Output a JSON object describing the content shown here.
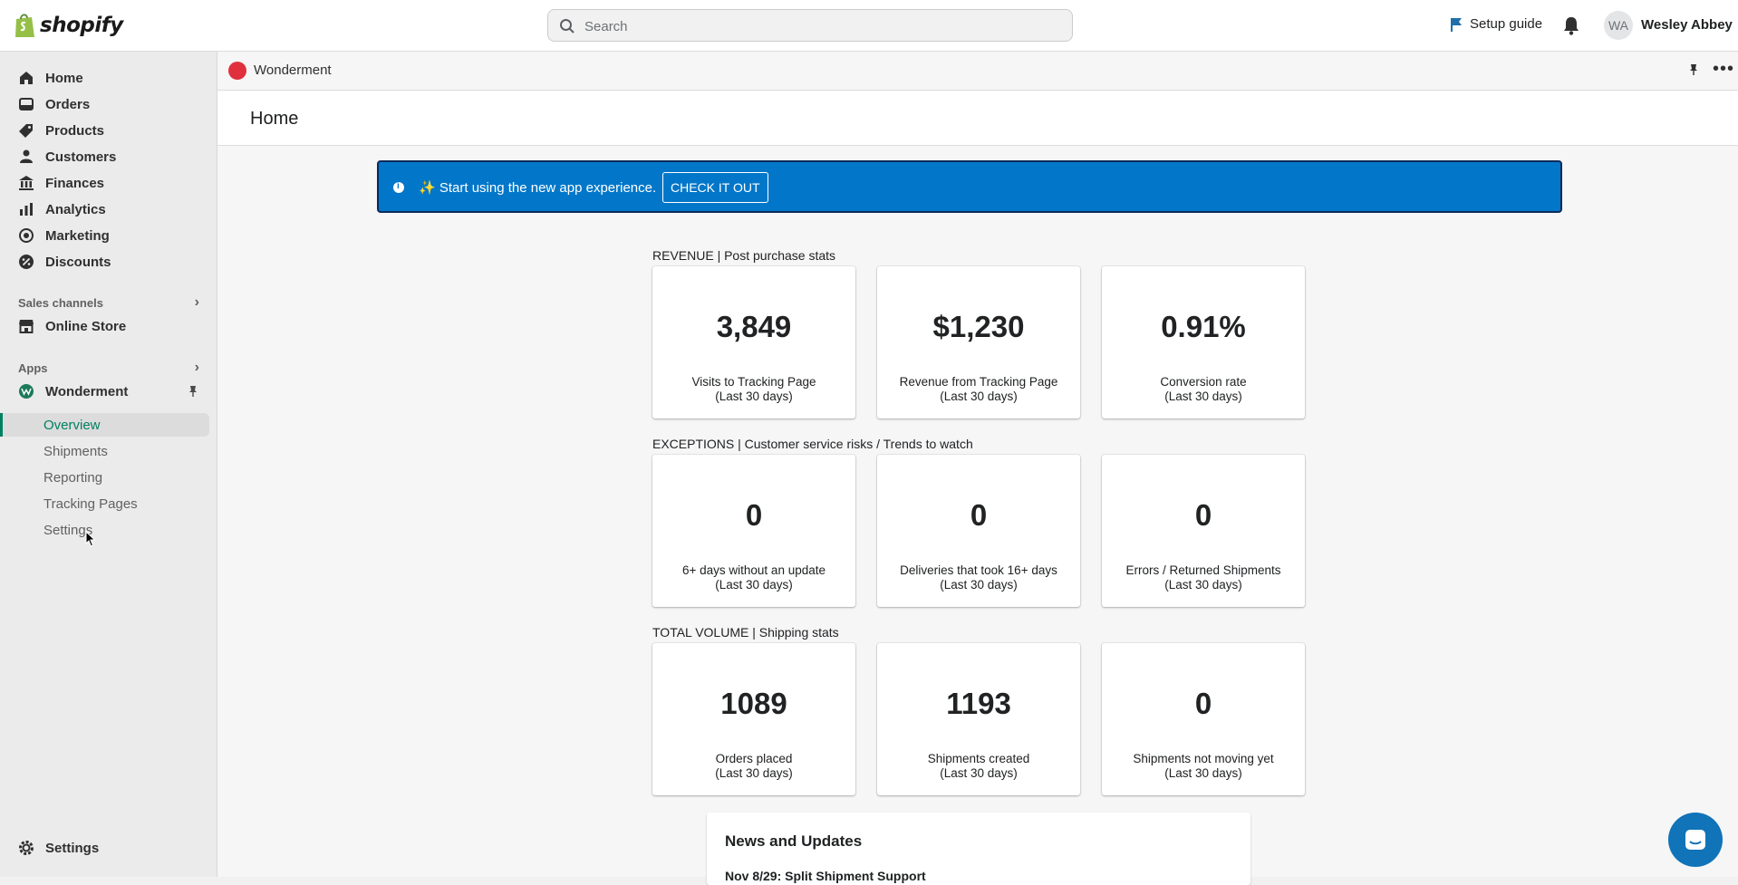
{
  "topbar": {
    "logo_text": "shopify",
    "search_placeholder": "Search",
    "setup_guide": "Setup guide",
    "avatar_initials": "WA",
    "user_name": "Wesley Abbey"
  },
  "sidebar": {
    "items": [
      {
        "label": "Home",
        "icon": "home-icon"
      },
      {
        "label": "Orders",
        "icon": "orders-icon"
      },
      {
        "label": "Products",
        "icon": "tag-icon"
      },
      {
        "label": "Customers",
        "icon": "person-icon"
      },
      {
        "label": "Finances",
        "icon": "bank-icon"
      },
      {
        "label": "Analytics",
        "icon": "bar-chart-icon"
      },
      {
        "label": "Marketing",
        "icon": "target-icon"
      },
      {
        "label": "Discounts",
        "icon": "discount-icon"
      }
    ],
    "sales_channels": "Sales channels",
    "online_store": "Online Store",
    "apps": "Apps",
    "app_name": "Wonderment",
    "sub_items": [
      "Overview",
      "Shipments",
      "Reporting",
      "Tracking Pages",
      "Settings"
    ],
    "active_sub": "Overview",
    "settings": "Settings"
  },
  "app_header": {
    "title": "Wonderment"
  },
  "page": {
    "title": "Home"
  },
  "banner": {
    "text": "✨ Start using the new app experience.",
    "button": "CHECK IT OUT"
  },
  "groups": [
    {
      "label": "REVENUE | Post purchase stats",
      "cards": [
        {
          "value": "3,849",
          "label1": "Visits to Tracking Page",
          "label2": "(Last 30 days)"
        },
        {
          "value": "$1,230",
          "label1": "Revenue from Tracking Page",
          "label2": "(Last 30 days)"
        },
        {
          "value": "0.91%",
          "label1": "Conversion rate",
          "label2": "(Last 30 days)"
        }
      ]
    },
    {
      "label": "EXCEPTIONS | Customer service risks / Trends to watch",
      "cards": [
        {
          "value": "0",
          "label1": "6+ days without an update",
          "label2": "(Last 30 days)"
        },
        {
          "value": "0",
          "label1": "Deliveries that took 16+ days",
          "label2": "(Last 30 days)"
        },
        {
          "value": "0",
          "label1": "Errors / Returned Shipments",
          "label2": "(Last 30 days)"
        }
      ]
    },
    {
      "label": "TOTAL VOLUME | Shipping stats",
      "cards": [
        {
          "value": "1089",
          "label1": "Orders placed",
          "label2": "(Last 30 days)"
        },
        {
          "value": "1193",
          "label1": "Shipments created",
          "label2": "(Last 30 days)"
        },
        {
          "value": "0",
          "label1": "Shipments not moving yet",
          "label2": "(Last 30 days)"
        }
      ]
    }
  ],
  "news": {
    "title": "News and Updates",
    "first_item": "Nov 8/29: Split Shipment Support"
  },
  "colors": {
    "banner": "#0277c9",
    "active_indicator": "#008060",
    "app_brand": "#e0303e",
    "chat": "#1173b8"
  }
}
